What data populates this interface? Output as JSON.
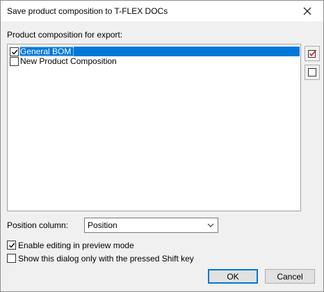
{
  "dialog": {
    "title": "Save product composition to T-FLEX DOCs",
    "close_icon": "close-icon"
  },
  "composition": {
    "label": "Product composition for export:",
    "items": [
      {
        "label": "General BOM",
        "checked": true,
        "selected": true
      },
      {
        "label": "New Product Composition",
        "checked": false,
        "selected": false
      }
    ],
    "check_all_icon": "check-all-icon",
    "uncheck_all_icon": "uncheck-all-icon"
  },
  "position_column": {
    "label": "Position column:",
    "value": "Position"
  },
  "options": {
    "enable_editing": {
      "label": "Enable editing in preview mode",
      "checked": true
    },
    "shift_only": {
      "label": "Show this dialog only with the pressed Shift key",
      "checked": false
    }
  },
  "buttons": {
    "ok": "OK",
    "cancel": "Cancel"
  },
  "colors": {
    "selection": "#0078d7",
    "accent_red": "#d9232e"
  }
}
